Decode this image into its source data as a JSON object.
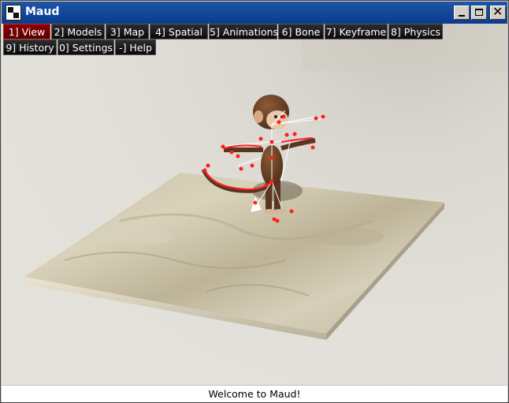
{
  "window": {
    "title": "Maud",
    "controls": {
      "minimize": "minimize",
      "maximize": "maximize",
      "close": "✕"
    }
  },
  "menu": {
    "row1": [
      {
        "label": "1] View",
        "active": true
      },
      {
        "label": "2] Models",
        "active": false
      },
      {
        "label": "3] Map",
        "active": false
      },
      {
        "label": "4] Spatial",
        "active": false
      },
      {
        "label": "5] Animations",
        "active": false
      },
      {
        "label": "6] Bone",
        "active": false
      },
      {
        "label": "7] Keyframe",
        "active": false
      },
      {
        "label": "8] Physics",
        "active": false
      }
    ],
    "row2": [
      {
        "label": "9] History",
        "active": false
      },
      {
        "label": "0] Settings",
        "active": false
      },
      {
        "label": "-] Help",
        "active": false
      }
    ]
  },
  "scene": {
    "model": "animated monkey character with skeleton overlay",
    "platform": "stone terrain slab",
    "skeleton_color": "#ff1e1e"
  },
  "status": {
    "text": "Welcome to Maud!"
  },
  "colors": {
    "titlebar": "#0a3b8c",
    "active_tab": "#7a0000",
    "menu_bg": "#111111"
  }
}
